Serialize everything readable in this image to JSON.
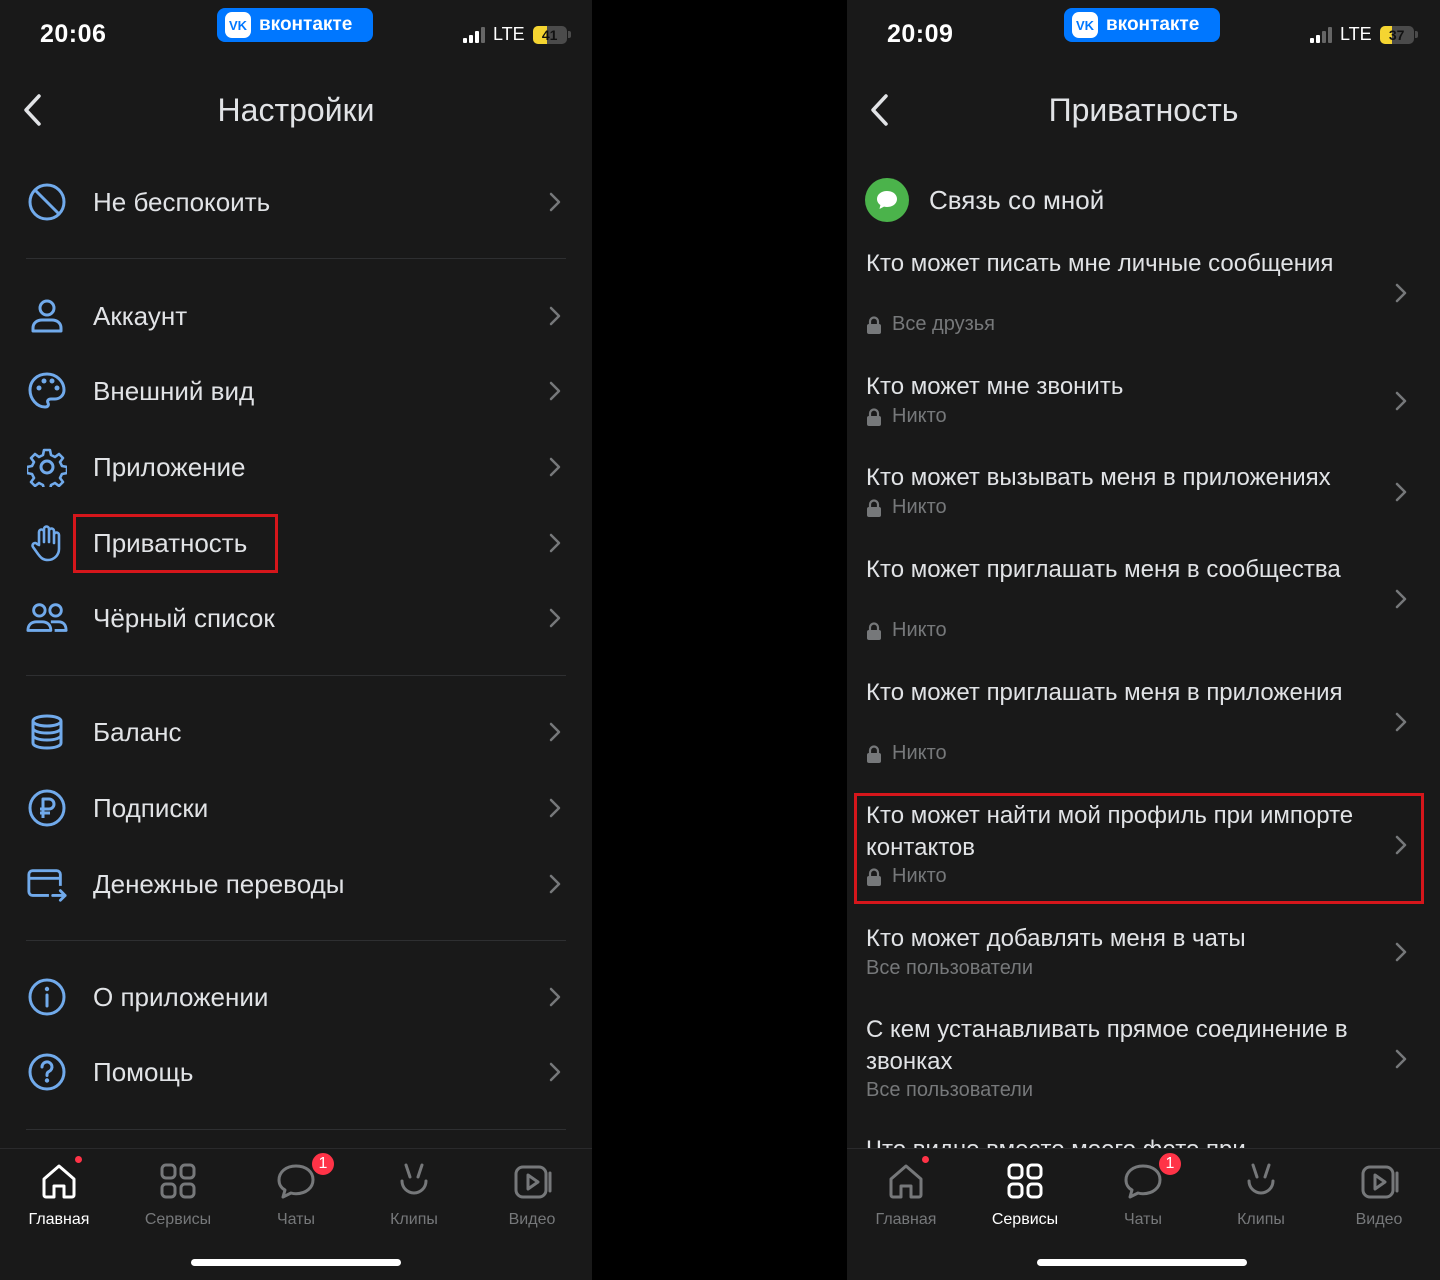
{
  "left": {
    "status": {
      "time": "20:06",
      "network": "LTE",
      "battery": "41",
      "battery_level": 0.41
    },
    "vk_pill": "вконтакте",
    "title": "Настройки",
    "items": [
      {
        "label": "Не беспокоить",
        "icon": "do-not-disturb-icon"
      },
      {
        "label": "Аккаунт",
        "icon": "user-icon"
      },
      {
        "label": "Внешний вид",
        "icon": "palette-icon"
      },
      {
        "label": "Приложение",
        "icon": "gear-icon"
      },
      {
        "label": "Приватность",
        "icon": "hand-icon",
        "highlighted": true
      },
      {
        "label": "Чёрный список",
        "icon": "users-icon"
      },
      {
        "label": "Баланс",
        "icon": "coins-icon"
      },
      {
        "label": "Подписки",
        "icon": "ruble-icon"
      },
      {
        "label": "Денежные переводы",
        "icon": "card-transfer-icon"
      },
      {
        "label": "О приложении",
        "icon": "info-icon"
      },
      {
        "label": "Помощь",
        "icon": "help-icon"
      }
    ],
    "tabs": [
      {
        "label": "Главная",
        "active": true,
        "dot": true
      },
      {
        "label": "Сервисы"
      },
      {
        "label": "Чаты",
        "badge": "1"
      },
      {
        "label": "Клипы"
      },
      {
        "label": "Видео"
      }
    ]
  },
  "right": {
    "status": {
      "time": "20:09",
      "network": "LTE",
      "battery": "37",
      "battery_level": 0.37
    },
    "vk_pill": "вконтакте",
    "title": "Приватность",
    "section": "Связь со мной",
    "items": [
      {
        "title": "Кто может писать мне личные сообщения",
        "value": "Все друзья",
        "locked": true
      },
      {
        "title": "Кто может мне звонить",
        "value": "Никто",
        "locked": true
      },
      {
        "title": "Кто может вызывать меня в приложениях",
        "value": "Никто",
        "locked": true
      },
      {
        "title": "Кто может приглашать меня в сообщества",
        "value": "Никто",
        "locked": true
      },
      {
        "title": "Кто может приглашать меня в приложения",
        "value": "Никто",
        "locked": true
      },
      {
        "title": "Кто может найти мой профиль при импорте контактов",
        "value": "Никто",
        "locked": true,
        "highlighted": true
      },
      {
        "title": "Кто может добавлять меня в чаты",
        "value": "Все пользователи",
        "locked": false
      },
      {
        "title": "С кем устанавливать прямое соединение в звонках",
        "value": "Все пользователи",
        "locked": false
      }
    ],
    "partial_item": "Что видно вместо моего фото при",
    "tabs": [
      {
        "label": "Главная",
        "dot": true
      },
      {
        "label": "Сервисы",
        "active": true
      },
      {
        "label": "Чаты",
        "badge": "1"
      },
      {
        "label": "Клипы"
      },
      {
        "label": "Видео"
      }
    ]
  },
  "colors": {
    "accent": "#0077ff",
    "highlight": "#d5161b",
    "badge": "#ff3347",
    "green": "#4bb34b",
    "icon_blue": "#71aaeb"
  }
}
